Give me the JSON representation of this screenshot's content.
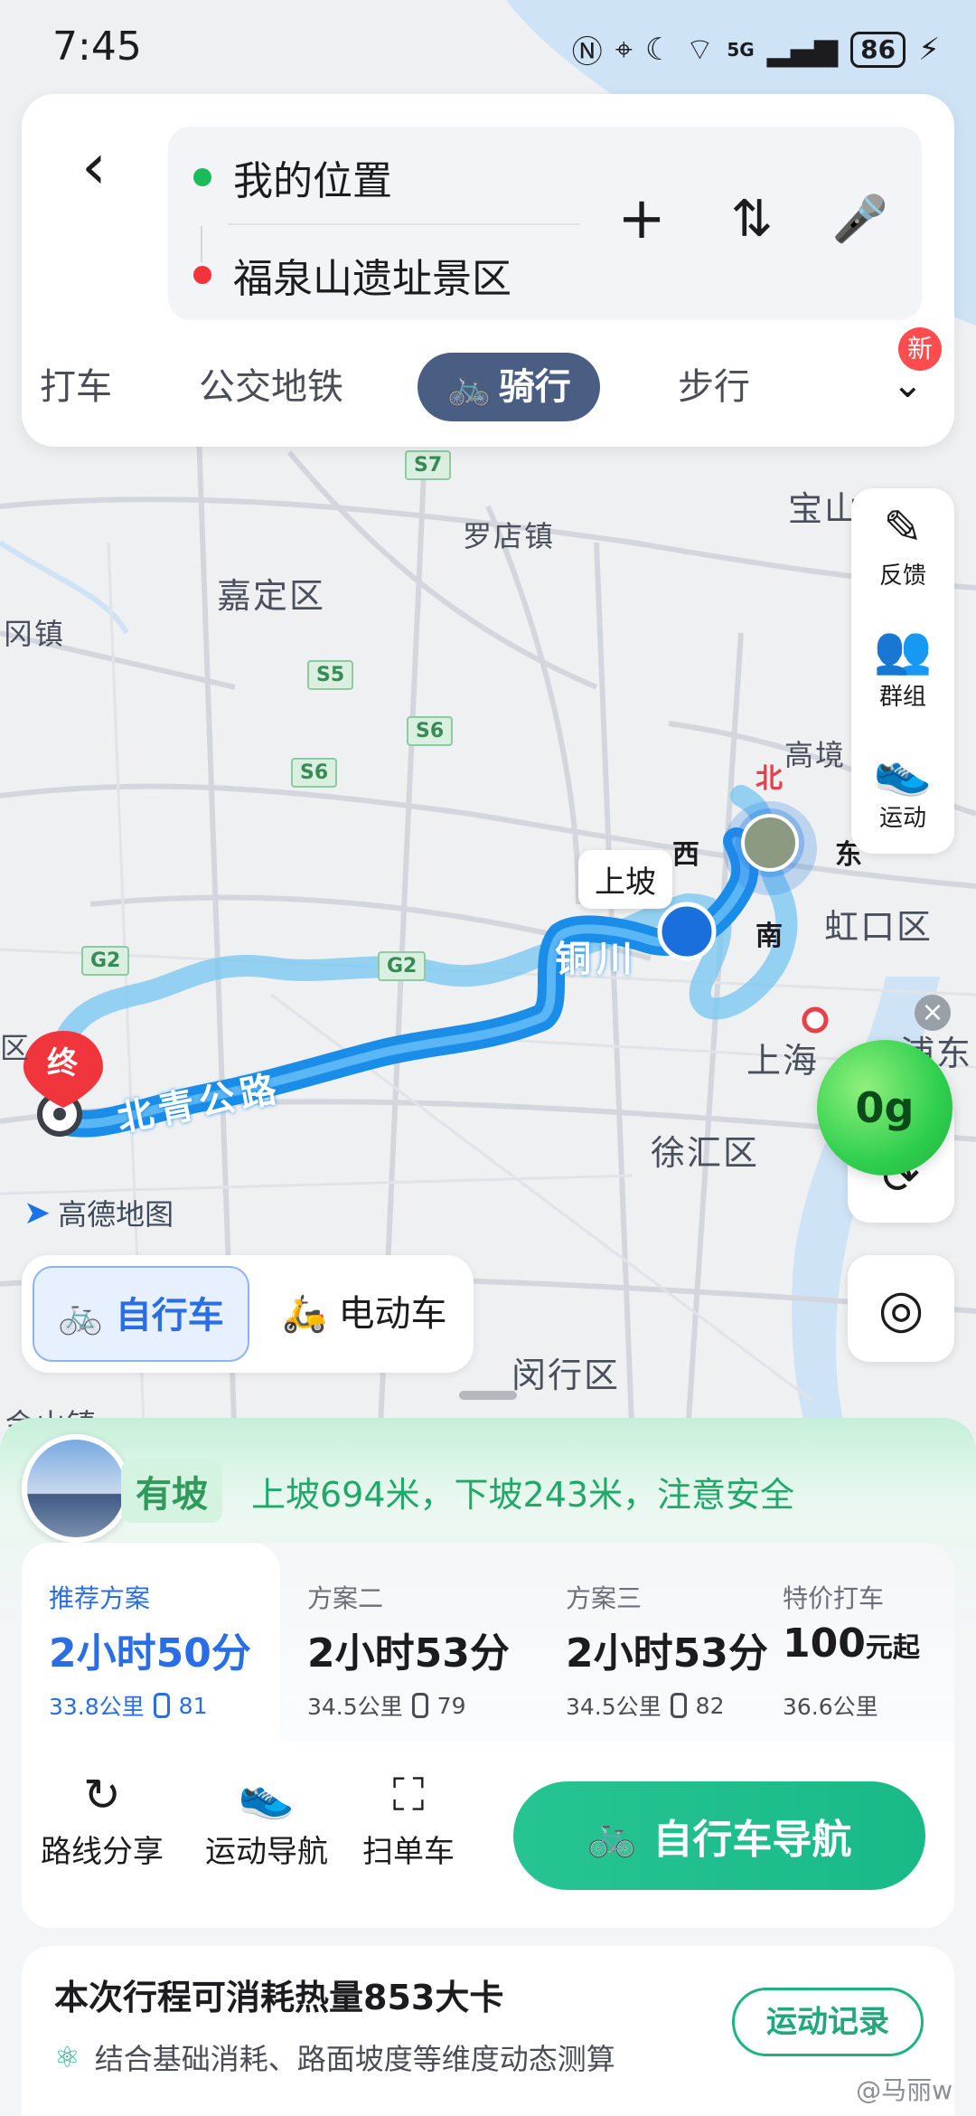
{
  "status_bar": {
    "time": "7:45",
    "network": "5G",
    "battery": "86"
  },
  "search": {
    "back_label": "‹",
    "origin": "我的位置",
    "destination": "福泉山遗址景区",
    "add_label": "+",
    "swap_label": "⇅",
    "voice_label": "🎤"
  },
  "colors": {
    "origin_dot": "#1dba5c",
    "dest_dot": "#f2333a",
    "accent": "#2a6ee6",
    "nav_green": "#1fb98a",
    "route_blue": "#1a8de9"
  },
  "mode_tabs": {
    "items": [
      {
        "label": "打车"
      },
      {
        "label": "公交地铁"
      },
      {
        "label": "骑行"
      },
      {
        "label": "步行"
      }
    ],
    "active": "骑行",
    "new_badge": "新"
  },
  "side_tools": {
    "items": [
      {
        "icon": "pen-icon",
        "label": "反馈"
      },
      {
        "icon": "group-icon",
        "label": "群组"
      },
      {
        "icon": "sport-shoe-icon",
        "label": "运动"
      }
    ]
  },
  "map": {
    "labels": [
      "嘉定区",
      "罗店镇",
      "宝山",
      "高境",
      "虹口区",
      "上海",
      "浦东",
      "徐汇区",
      "闵行区",
      "冈镇",
      "区",
      "金山镇"
    ],
    "road_shields": [
      "S7",
      "S5",
      "S6",
      "S6",
      "G2",
      "G2"
    ],
    "route_road_labels": [
      "北青公路",
      "铜川"
    ],
    "uphill_popup": "上坡",
    "end_marker": "终",
    "compass": {
      "north": "北",
      "west": "西",
      "east": "东",
      "south": "南"
    },
    "logo": "高德地图",
    "eco_value": "0g",
    "eco_close": "×"
  },
  "vehicle_toggle": {
    "bicycle": "自行车",
    "ebike": "电动车",
    "active": "自行车"
  },
  "slope": {
    "tag": "有坡",
    "text": "上坡694米，下坡243米，注意安全"
  },
  "plans": [
    {
      "name": "推荐方案",
      "time": "2小时50分",
      "distance": "33.8公里",
      "lights": "81"
    },
    {
      "name": "方案二",
      "time": "2小时53分",
      "distance": "34.5公里",
      "lights": "79"
    },
    {
      "name": "方案三",
      "time": "2小时53分",
      "distance": "34.5公里",
      "lights": "82"
    },
    {
      "name": "特价打车",
      "price": "100",
      "price_suffix": "元起",
      "distance": "36.6公里"
    }
  ],
  "actions": {
    "share": "路线分享",
    "sport_nav": "运动导航",
    "scan_bike": "扫单车",
    "nav_button": "自行车导航"
  },
  "calorie": {
    "title": "本次行程可消耗热量853大卡",
    "subtitle": "结合基础消耗、路面坡度等维度动态测算",
    "record_button": "运动记录"
  },
  "watermark": "@马丽w"
}
